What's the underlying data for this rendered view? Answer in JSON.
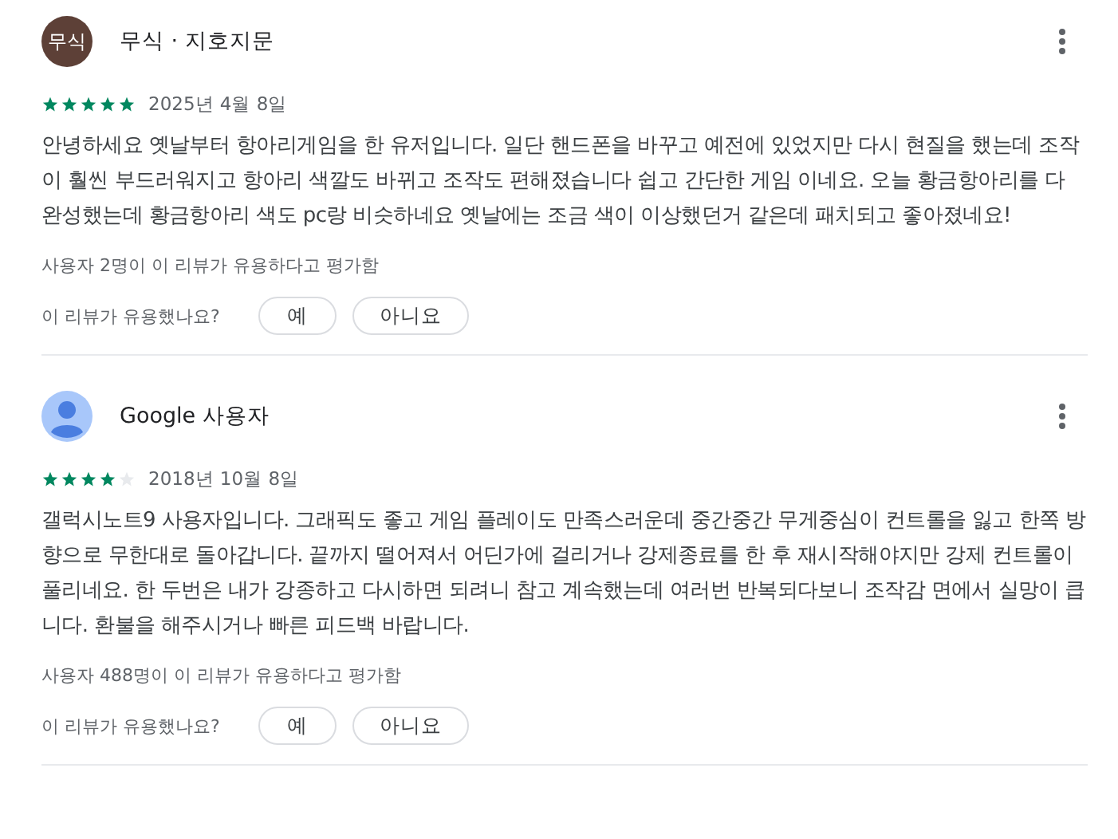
{
  "reviews": [
    {
      "avatar": {
        "kind": "initials",
        "text": "무식",
        "color": "#5d4037"
      },
      "author": "무식 · 지호지문",
      "stars": 5,
      "date": "2025년 4월 8일",
      "body": "안녕하세요 옛날부터 항아리게임을 한 유저입니다. 일단 핸드폰을 바꾸고 예전에 있었지만 다시 현질을 했는데 조작이 훨씬 부드러워지고 항아리 색깔도 바뀌고 조작도 편해졌습니다 쉽고 간단한 게임 이네요. 오늘 황금항아리를 다 완성했는데 황금항아리 색도 pc랑 비슷하네요 옛날에는 조금 색이 이상했던거 같은데 패치되고 좋아졌네요!",
      "helpful_count": "사용자 2명이 이 리뷰가 유용하다고 평가함",
      "helpful_question": "이 리뷰가 유용했나요?",
      "buttons": [
        "예",
        "아니요"
      ]
    },
    {
      "avatar": {
        "kind": "silhouette"
      },
      "author": "Google 사용자",
      "stars": 4,
      "date": "2018년 10월 8일",
      "body": "갤럭시노트9 사용자입니다. 그래픽도 좋고 게임 플레이도 만족스러운데 중간중간 무게중심이 컨트롤을 잃고 한쪽 방향으로 무한대로 돌아갑니다. 끝까지 떨어져서 어딘가에 걸리거나 강제종료를 한 후 재시작해야지만 강제 컨트롤이 풀리네요. 한 두번은 내가 강종하고 다시하면 되려니 참고 계속했는데 여러번 반복되다보니 조작감 면에서 실망이 큽니다. 환불을 해주시거나 빠른 피드백 바랍니다.",
      "helpful_count": "사용자 488명이 이 리뷰가 유용하다고 평가함",
      "helpful_question": "이 리뷰가 유용했나요?",
      "buttons": [
        "예",
        "아니요"
      ]
    }
  ]
}
